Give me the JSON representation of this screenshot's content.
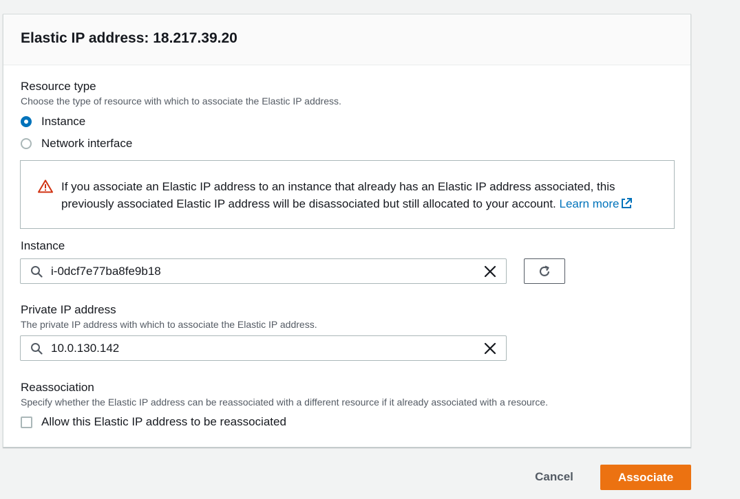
{
  "panel": {
    "title": "Elastic IP address: 18.217.39.20"
  },
  "resource_type": {
    "label": "Resource type",
    "description": "Choose the type of resource with which to associate the Elastic IP address.",
    "options": [
      {
        "label": "Instance",
        "selected": true
      },
      {
        "label": "Network interface",
        "selected": false
      }
    ]
  },
  "alert": {
    "text": "If you associate an Elastic IP address to an instance that already has an Elastic IP address associated, this previously associated Elastic IP address will be disassociated but still allocated to your account. ",
    "link_label": "Learn more",
    "icon": "warning-icon"
  },
  "instance": {
    "label": "Instance",
    "value": "i-0dcf7e77ba8fe9b18"
  },
  "private_ip": {
    "label": "Private IP address",
    "description": "The private IP address with which to associate the Elastic IP address.",
    "value": "10.0.130.142"
  },
  "reassociation": {
    "label": "Reassociation",
    "description": "Specify whether the Elastic IP address can be reassociated with a different resource if it already associated with a resource.",
    "checkbox_label": "Allow this Elastic IP address to be reassociated",
    "checked": false
  },
  "footer": {
    "cancel_label": "Cancel",
    "associate_label": "Associate"
  },
  "colors": {
    "primary": "#ec7211",
    "link": "#0073bb",
    "warning": "#d13212"
  }
}
